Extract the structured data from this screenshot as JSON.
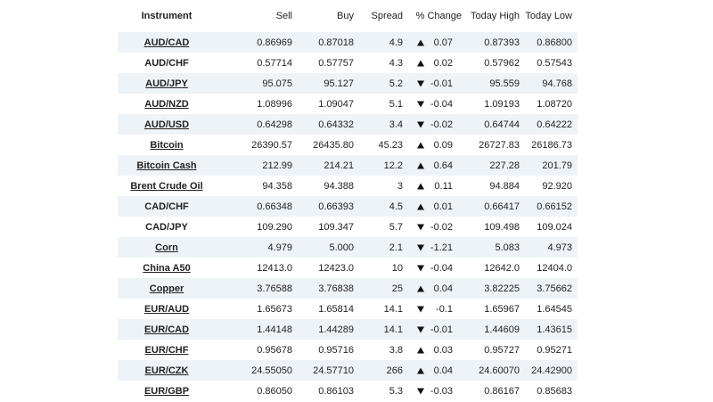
{
  "table": {
    "headers": {
      "instrument": "Instrument",
      "sell": "Sell",
      "buy": "Buy",
      "spread": "Spread",
      "change": "% Change",
      "high": "Today High",
      "low": "Today Low"
    },
    "rows": [
      {
        "instrument": "AUD/CAD",
        "link": true,
        "sell": "0.86969",
        "buy": "0.87018",
        "spread": "4.9",
        "dir": "up",
        "change": "0.07",
        "high": "0.87393",
        "low": "0.86800"
      },
      {
        "instrument": "AUD/CHF",
        "link": false,
        "sell": "0.57714",
        "buy": "0.57757",
        "spread": "4.3",
        "dir": "up",
        "change": "0.02",
        "high": "0.57962",
        "low": "0.57543"
      },
      {
        "instrument": "AUD/JPY",
        "link": true,
        "sell": "95.075",
        "buy": "95.127",
        "spread": "5.2",
        "dir": "down",
        "change": "-0.01",
        "high": "95.559",
        "low": "94.768"
      },
      {
        "instrument": "AUD/NZD",
        "link": true,
        "sell": "1.08996",
        "buy": "1.09047",
        "spread": "5.1",
        "dir": "down",
        "change": "-0.04",
        "high": "1.09193",
        "low": "1.08720"
      },
      {
        "instrument": "AUD/USD",
        "link": true,
        "sell": "0.64298",
        "buy": "0.64332",
        "spread": "3.4",
        "dir": "down",
        "change": "-0.02",
        "high": "0.64744",
        "low": "0.64222"
      },
      {
        "instrument": "Bitcoin",
        "link": true,
        "sell": "26390.57",
        "buy": "26435.80",
        "spread": "45.23",
        "dir": "up",
        "change": "0.09",
        "high": "26727.83",
        "low": "26186.73"
      },
      {
        "instrument": "Bitcoin Cash",
        "link": true,
        "sell": "212.99",
        "buy": "214.21",
        "spread": "12.2",
        "dir": "up",
        "change": "0.64",
        "high": "227.28",
        "low": "201.79"
      },
      {
        "instrument": "Brent Crude Oil",
        "link": true,
        "sell": "94.358",
        "buy": "94.388",
        "spread": "3",
        "dir": "up",
        "change": "0.11",
        "high": "94.884",
        "low": "92.920"
      },
      {
        "instrument": "CAD/CHF",
        "link": false,
        "sell": "0.66348",
        "buy": "0.66393",
        "spread": "4.5",
        "dir": "up",
        "change": "0.01",
        "high": "0.66417",
        "low": "0.66152"
      },
      {
        "instrument": "CAD/JPY",
        "link": false,
        "sell": "109.290",
        "buy": "109.347",
        "spread": "5.7",
        "dir": "down",
        "change": "-0.02",
        "high": "109.498",
        "low": "109.024"
      },
      {
        "instrument": "Corn",
        "link": true,
        "sell": "4.979",
        "buy": "5.000",
        "spread": "2.1",
        "dir": "down",
        "change": "-1.21",
        "high": "5.083",
        "low": "4.973"
      },
      {
        "instrument": "China A50",
        "link": true,
        "sell": "12413.0",
        "buy": "12423.0",
        "spread": "10",
        "dir": "down",
        "change": "-0.04",
        "high": "12642.0",
        "low": "12404.0"
      },
      {
        "instrument": "Copper",
        "link": true,
        "sell": "3.76588",
        "buy": "3.76838",
        "spread": "25",
        "dir": "up",
        "change": "0.04",
        "high": "3.82225",
        "low": "3.75662"
      },
      {
        "instrument": "EUR/AUD",
        "link": true,
        "sell": "1.65673",
        "buy": "1.65814",
        "spread": "14.1",
        "dir": "down",
        "change": "-0.1",
        "high": "1.65967",
        "low": "1.64545"
      },
      {
        "instrument": "EUR/CAD",
        "link": true,
        "sell": "1.44148",
        "buy": "1.44289",
        "spread": "14.1",
        "dir": "down",
        "change": "-0.01",
        "high": "1.44609",
        "low": "1.43615"
      },
      {
        "instrument": "EUR/CHF",
        "link": true,
        "sell": "0.95678",
        "buy": "0.95716",
        "spread": "3.8",
        "dir": "up",
        "change": "0.03",
        "high": "0.95727",
        "low": "0.95271"
      },
      {
        "instrument": "EUR/CZK",
        "link": true,
        "sell": "24.55050",
        "buy": "24.57710",
        "spread": "266",
        "dir": "up",
        "change": "0.04",
        "high": "24.60070",
        "low": "24.42900"
      },
      {
        "instrument": "EUR/GBP",
        "link": true,
        "sell": "0.86050",
        "buy": "0.86103",
        "spread": "5.3",
        "dir": "down",
        "change": "-0.03",
        "high": "0.86167",
        "low": "0.85683"
      }
    ]
  }
}
